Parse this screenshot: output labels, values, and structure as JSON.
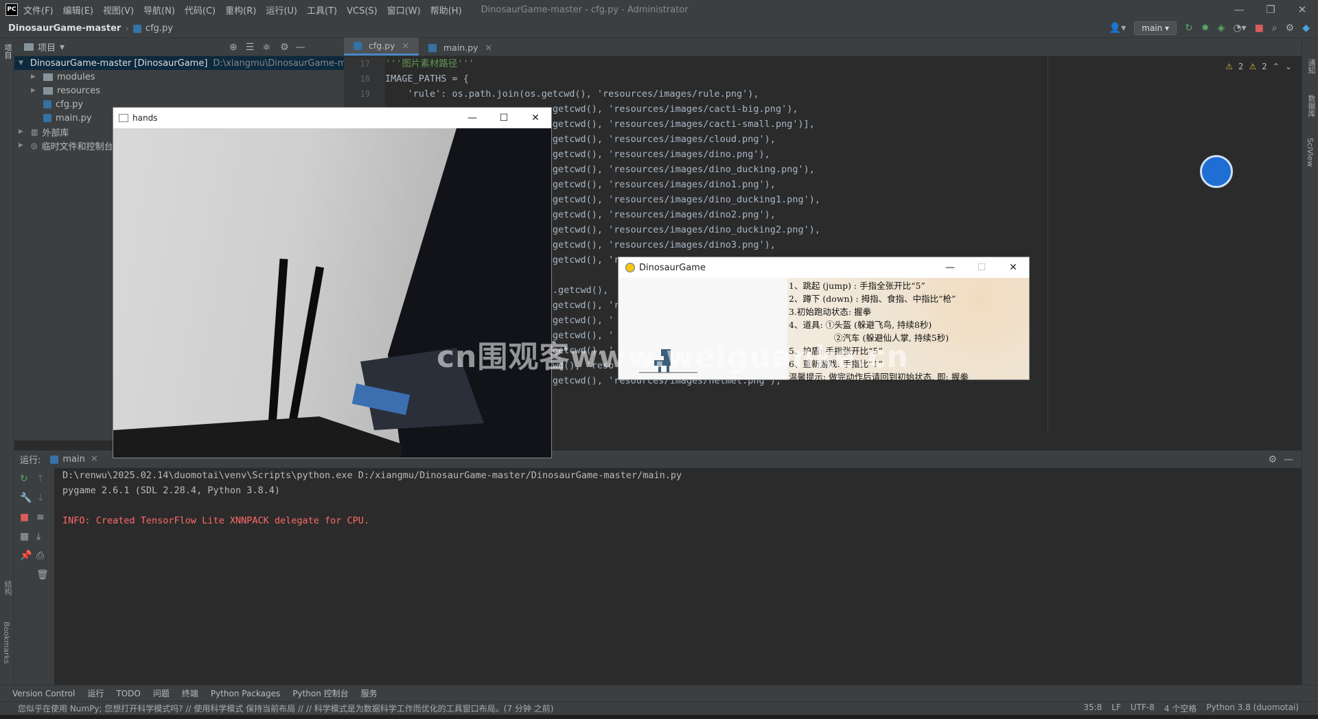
{
  "titlebar": {
    "logo": "PC",
    "menus": [
      "文件(F)",
      "编辑(E)",
      "视图(V)",
      "导航(N)",
      "代码(C)",
      "重构(R)",
      "运行(U)",
      "工具(T)",
      "VCS(S)",
      "窗口(W)",
      "帮助(H)"
    ],
    "window_title": "DinosaurGame-master - cfg.py - Administrator"
  },
  "navbar": {
    "project": "DinosaurGame-master",
    "file": "cfg.py",
    "run_config": "main"
  },
  "project_panel": {
    "header": "项目",
    "tree": [
      {
        "label": "DinosaurGame-master [DinosaurGame]",
        "path": "D:\\xiangmu\\DinosaurGame-master",
        "type": "root"
      },
      {
        "label": "modules",
        "type": "folder"
      },
      {
        "label": "resources",
        "type": "folder"
      },
      {
        "label": "cfg.py",
        "type": "py"
      },
      {
        "label": "main.py",
        "type": "py"
      },
      {
        "label": "外部库",
        "type": "lib"
      },
      {
        "label": "临时文件和控制台",
        "type": "scratch"
      }
    ]
  },
  "editor": {
    "tabs": [
      "cfg.py",
      "main.py"
    ],
    "inspections": {
      "warnings": "2",
      "weak": "2"
    },
    "line_numbers": [
      "17",
      "18",
      "19"
    ],
    "lines": [
      {
        "text": "'''图片素材路径'''",
        "cls": "comment"
      },
      {
        "text": "IMAGE_PATHS = {",
        "cls": ""
      },
      {
        "text": "    'rule': os.path.join(os.getcwd(), 'resources/images/rule.png'),",
        "cls": ""
      },
      {
        "text": "                              getcwd(), 'resources/images/cacti-big.png'),",
        "cls": ""
      },
      {
        "text": "                              getcwd(), 'resources/images/cacti-small.png')],",
        "cls": ""
      },
      {
        "text": "                              getcwd(), 'resources/images/cloud.png'),",
        "cls": ""
      },
      {
        "text": "                              getcwd(), 'resources/images/dino.png'),",
        "cls": ""
      },
      {
        "text": "                              getcwd(), 'resources/images/dino_ducking.png'),",
        "cls": ""
      },
      {
        "text": "                              getcwd(), 'resources/images/dino1.png'),",
        "cls": ""
      },
      {
        "text": "                              getcwd(), 'resources/images/dino_ducking1.png'),",
        "cls": ""
      },
      {
        "text": "                              getcwd(), 'resources/images/dino2.png'),",
        "cls": ""
      },
      {
        "text": "                              getcwd(), 'resources/images/dino_ducking2.png'),",
        "cls": ""
      },
      {
        "text": "                              getcwd(), 'resources/images/dino3.png'),",
        "cls": ""
      },
      {
        "text": "                              getcwd(), 're",
        "cls": ""
      },
      {
        "text": "",
        "cls": ""
      },
      {
        "text": "                             s.getcwd(),",
        "cls": ""
      },
      {
        "text": "                              getcwd(), 'r",
        "cls": ""
      },
      {
        "text": "                             .getcwd(), '",
        "cls": ""
      },
      {
        "text": "                              getcwd(), '",
        "cls": ""
      },
      {
        "text": "                              getcwd(), '",
        "cls": ""
      },
      {
        "text": "                             cwd(), 'reso",
        "cls": ""
      },
      {
        "text": "                              getcwd(), 'resources/images/helmet.png'),",
        "cls": ""
      }
    ]
  },
  "right_strip": [
    "通知",
    "数据库",
    "SciView"
  ],
  "run_panel": {
    "label": "运行:",
    "tab": "main",
    "console": [
      {
        "text": "D:\\renwu\\2025.02.14\\duomotai\\venv\\Scripts\\python.exe D:/xiangmu/DinosaurGame-master/DinosaurGame-master/main.py",
        "err": false
      },
      {
        "text": "pygame 2.6.1 (SDL 2.28.4, Python 3.8.4)",
        "err": false
      },
      {
        "text": "",
        "err": false
      },
      {
        "text": "INFO: Created TensorFlow Lite XNNPACK delegate for CPU.",
        "err": true
      }
    ]
  },
  "left_strip": [
    "项目",
    "结构",
    "Bookmarks"
  ],
  "toolwindows": [
    "Version Control",
    "运行",
    "TODO",
    "问题",
    "终端",
    "Python Packages",
    "Python 控制台",
    "服务"
  ],
  "statusbar": {
    "message": "您似乎在使用 NumPy; 您想打开科学模式吗? // 使用科学模式   保持当前布局 // // 科学模式是为数据科学工作而优化的工具窗口布局。(7 分钟 之前)",
    "position": "35:8",
    "line_sep": "LF",
    "encoding": "UTF-8",
    "indent": "4 个空格",
    "interpreter": "Python 3.8 (duomotai)"
  },
  "hands_window": {
    "title": "hands"
  },
  "dino_window": {
    "title": "DinosaurGame",
    "rules": [
      "1、跳起 (jump) : 手指全张开比“5”",
      "2、蹲下 (down) : 拇指、食指、中指比“枪”",
      "3.初始跑动状态: 握拳",
      "4、道具: ①头盔 (躲避飞鸟, 持续8秒)",
      "②汽车 (躲避仙人掌, 持续5秒)",
      "5、护盾: 手指张开比“5”",
      "6、重新游戏: 手指比“1”",
      "温馨提示: 做完动作后请回到初始状态, 即: 握拳"
    ]
  },
  "watermark": "cn围观客www.weiguanke.cn"
}
